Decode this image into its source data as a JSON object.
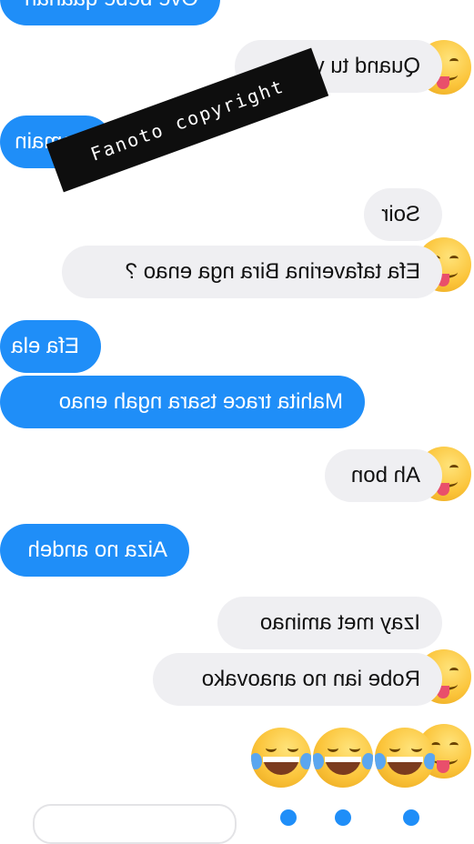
{
  "messages": [
    {
      "id": "m0",
      "text": "Ove bebe qaanah"
    },
    {
      "id": "m1",
      "text": "Quand tu veux"
    },
    {
      "id": "m2",
      "text": "Demain"
    },
    {
      "id": "m3",
      "text": "Soir"
    },
    {
      "id": "m4",
      "text": "Efa tafaverina Bira nga enao ?"
    },
    {
      "id": "m5",
      "text": "Efa ela"
    },
    {
      "id": "m6",
      "text": "Mahita trace tsara ngah enao"
    },
    {
      "id": "m7",
      "text": "Ah bon"
    },
    {
      "id": "m8",
      "text": "Aiza no andeh"
    },
    {
      "id": "m9",
      "text": "Izay met aminao"
    },
    {
      "id": "m10",
      "text": "Robe ian no anaovako"
    }
  ],
  "watermark": {
    "text": "Fanoto copyright"
  },
  "reaction": {
    "emoji_names": [
      "laughing-tears-icon",
      "laughing-tears-icon",
      "laughing-tears-icon"
    ]
  },
  "colors": {
    "sent": "#1f8ef8",
    "received": "#efeff2"
  }
}
